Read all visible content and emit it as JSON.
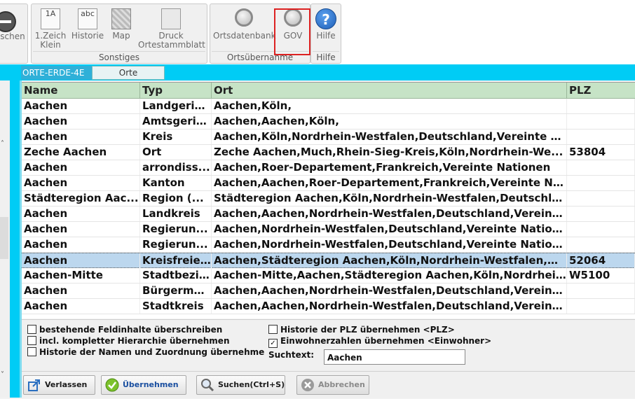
{
  "ribbon": {
    "partial_button_label": "schen",
    "groups": {
      "sonstiges": {
        "label": "Sonstiges",
        "buttons": [
          {
            "label_line1": "1.Zeich",
            "label_line2": "Klein",
            "icon": "font-case-icon"
          },
          {
            "label_line1": "Historie",
            "label_line2": "",
            "icon": "history-icon"
          },
          {
            "label_line1": "Map",
            "label_line2": "",
            "icon": "map-icon"
          },
          {
            "label_line1": "Druck",
            "label_line2": "Ortestammblatt",
            "icon": "print-icon"
          }
        ]
      },
      "ortsuebernahme": {
        "label": "Ortsübernahme",
        "buttons": [
          {
            "label": "Ortsdatenbank",
            "icon": "magnifier-icon"
          },
          {
            "label": "GOV",
            "icon": "magnifier-icon"
          }
        ]
      },
      "hilfe": {
        "label": "Hilfe",
        "button_label": "Hilfe",
        "icon_glyph": "?"
      }
    }
  },
  "tabs": [
    "ORTE-ERDE-4E",
    "Orte"
  ],
  "table": {
    "columns": [
      "Name",
      "Typ",
      "Ort",
      "PLZ"
    ],
    "rows": [
      [
        "Aachen",
        "Landgericht",
        "Aachen,Köln,",
        ""
      ],
      [
        "Aachen",
        "Amtsgericht",
        "Aachen,Aachen,Köln,",
        ""
      ],
      [
        "Aachen",
        "Kreis",
        "Aachen,Köln,Nordrhein-Westfalen,Deutschland,Vereinte N...",
        ""
      ],
      [
        "Zeche Aachen",
        "Ort",
        "Zeche Aachen,Much,Rhein-Sieg-Kreis,Köln,Nordrhein-We...",
        "53804"
      ],
      [
        "Aachen",
        "arrondiss...",
        "Aachen,Roer-Departement,Frankreich,Vereinte Nationen",
        ""
      ],
      [
        "Aachen",
        "Kanton",
        "Aachen,Aachen,Roer-Departement,Frankreich,Vereinte Nat...",
        ""
      ],
      [
        "Städteregion Aac...",
        "Region (...",
        "Städteregion Aachen,Köln,Nordrhein-Westfalen,Deutschla...",
        ""
      ],
      [
        "Aachen",
        "Landkreis",
        "Aachen,Aachen,Nordrhein-Westfalen,Deutschland,Vereint...",
        ""
      ],
      [
        "Aachen",
        "Regierun...",
        "Aachen,Nordrhein-Westfalen,Deutschland,Vereinte Nationen",
        ""
      ],
      [
        "Aachen",
        "Regierun...",
        "Aachen,Nordrhein-Westfalen,Deutschland,Vereinte Nationen",
        ""
      ],
      [
        "Aachen",
        "Kreisfreie...",
        "Aachen,Städteregion Aachen,Köln,Nordrhein-Westfalen,D...",
        "52064"
      ],
      [
        "Aachen-Mitte",
        "Stadtbezirk",
        "Aachen-Mitte,Aachen,Städteregion Aachen,Köln,Nordrhein...",
        "W5100"
      ],
      [
        "Aachen",
        "Bürgerme...",
        "Aachen,Aachen,Nordrhein-Westfalen,Deutschland,Vereint...",
        ""
      ],
      [
        "Aachen",
        "Stadtkreis",
        "Aachen,Aachen,Nordrhein-Westfalen,Deutschland,Vereint...",
        ""
      ]
    ],
    "selected_row_index": 10
  },
  "options": {
    "left": [
      {
        "label": "bestehende Feldinhalte überschreiben",
        "checked": false
      },
      {
        "label": "incl. kompletter Hierarchie übernehmen",
        "checked": false
      },
      {
        "label": "Historie der Namen und Zuordnung übernehme",
        "checked": false
      }
    ],
    "right": [
      {
        "label": "Historie der PLZ übernehmen <PLZ>",
        "checked": false
      },
      {
        "label": "Einwohnerzahlen übernehmen <Einwohner>",
        "checked": true
      }
    ],
    "search_label": "Suchtext:",
    "search_value": "Aachen"
  },
  "buttons": {
    "verlassen": "Verlassen",
    "uebernehmen": "Übernehmen",
    "suchen": "Suchen(Ctrl+S)",
    "abbrechen": "Abbrechen"
  },
  "colors": {
    "accent_cyan": "#00ccf5",
    "header_green": "#c6e3c6",
    "selection": "#bcd7ee",
    "highlight_red": "#d22222"
  }
}
